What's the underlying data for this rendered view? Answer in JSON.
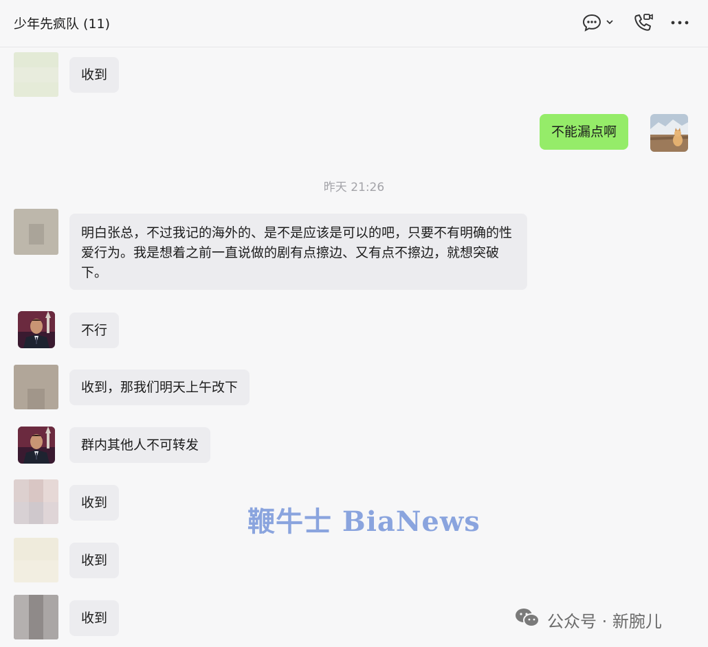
{
  "header": {
    "title": "少年先疯队 (11)",
    "icons": [
      "chat-bubble-icon",
      "chevron-down-icon",
      "voice-video-call-icon",
      "more-icon"
    ]
  },
  "messages": [
    {
      "side": "left",
      "avatar": "blurred-avatar-light-green",
      "text": "收到"
    },
    {
      "side": "right",
      "avatar": "dog-mountain-avatar",
      "text": "不能漏点啊"
    },
    {
      "side": "left",
      "avatar": "blurred-avatar-gray",
      "text": "明白张总，不过我记的海外的、是不是应该是可以的吧，只要不有明确的性爱行为。我是想着之前一直说做的剧有点擦边、又有点不擦边，就想突破下。"
    },
    {
      "side": "left",
      "avatar": "suited-man-avatar",
      "text": "不行"
    },
    {
      "side": "left",
      "avatar": "blurred-avatar-taupe",
      "text": "收到，那我们明天上午改下"
    },
    {
      "side": "left",
      "avatar": "suited-man-avatar",
      "text": "群内其他人不可转发"
    },
    {
      "side": "left",
      "avatar": "blurred-avatar-pink",
      "text": "收到"
    },
    {
      "side": "left",
      "avatar": "blurred-avatar-cream",
      "text": "收到"
    },
    {
      "side": "left",
      "avatar": "blurred-avatar-dark-gray",
      "text": "收到"
    }
  ],
  "timestamp": "昨天 21:26",
  "watermark": "鞭牛士 BiaNews",
  "footer_mark": "公众号 · 新腕儿",
  "colors": {
    "background": "#f7f7f8",
    "bubble_other": "#ececef",
    "bubble_mine": "#95ec69",
    "watermark": "#6f90d8"
  }
}
